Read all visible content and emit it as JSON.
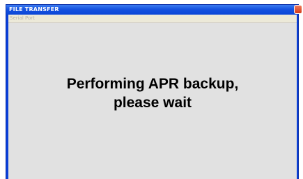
{
  "window": {
    "title": "FILE TRANSFER"
  },
  "menu": {
    "items": [
      {
        "label": "Serial Port"
      }
    ]
  },
  "message": {
    "line1": "Performing APR backup,",
    "line2": "please wait"
  },
  "colors": {
    "titlebar": "#1552e0",
    "client_background": "#e1e1e1",
    "close_button": "#d23a18"
  },
  "icons": {
    "close": "close-icon"
  }
}
